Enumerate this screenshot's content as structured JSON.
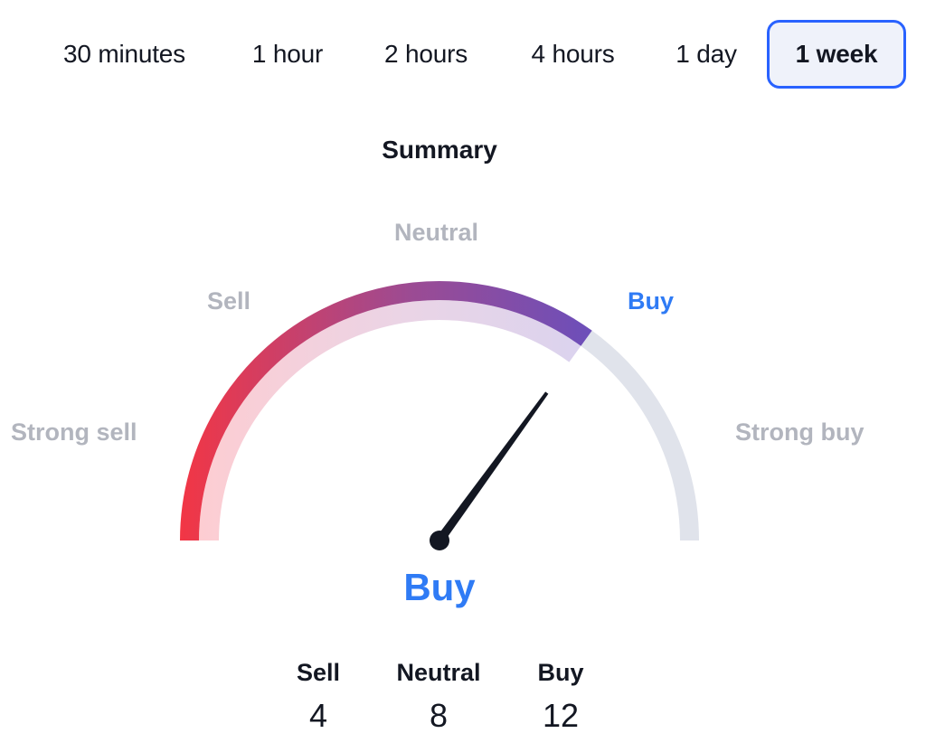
{
  "tabs": [
    {
      "label": "30 minutes",
      "active": false
    },
    {
      "label": "1 hour",
      "active": false
    },
    {
      "label": "2 hours",
      "active": false
    },
    {
      "label": "4 hours",
      "active": false
    },
    {
      "label": "1 day",
      "active": false
    },
    {
      "label": "1 week",
      "active": true
    }
  ],
  "summary": {
    "title": "Summary",
    "gauge": {
      "labels": {
        "strong_sell": "Strong sell",
        "sell": "Sell",
        "neutral": "Neutral",
        "buy": "Buy",
        "strong_buy": "Strong buy"
      },
      "active_label": "buy",
      "value_fraction": 0.7,
      "colors": {
        "start": "#f23645",
        "mid": "#9c4b93",
        "end": "#6b4fbb",
        "track": "#e0e3eb",
        "needle": "#131722",
        "active_text": "#2f7bf5",
        "muted_text": "#b2b5be"
      }
    },
    "verdict": "Buy",
    "counts": [
      {
        "label": "Sell",
        "value": "4"
      },
      {
        "label": "Neutral",
        "value": "8"
      },
      {
        "label": "Buy",
        "value": "12"
      }
    ]
  }
}
